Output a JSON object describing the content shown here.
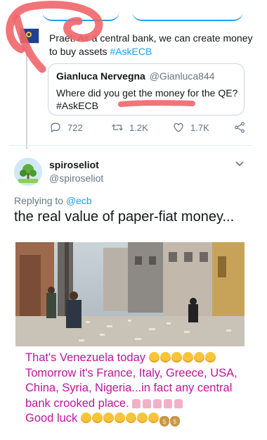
{
  "quoted_context": {
    "text_line1": "Praet: As a central bank, we can create money",
    "text_line2_prefix": "to buy assets ",
    "hashtag": "#AskECB"
  },
  "quote": {
    "author_name": "Gianluca Nervegna",
    "author_handle": "@Gianluca844",
    "text_line1": "Where did you get the money for the QE?",
    "hashtag": "#AskECB"
  },
  "actions": {
    "replies": "722",
    "retweets": "1.2K",
    "likes": "1.7K"
  },
  "reply_tweet": {
    "display_name": "spiroseliot",
    "handle": "@spiroseliot",
    "replying_to_prefix": "Replying to ",
    "replying_to_handle": "@ecb",
    "text": "the real value of paper-fiat money..."
  },
  "caption": {
    "line1": "That's Venezuela today",
    "line2": "Tomorrow it's France, Italy, Greece, USA,",
    "line3": "China, Syria, Nigeria...in fact any central",
    "line4": "bank crooked place.",
    "line5": "Good luck"
  },
  "colors": {
    "accent": "#1da1f2",
    "caption": "#c0159b",
    "annotation_red": "#f0656a"
  },
  "icons": [
    "reply-icon",
    "retweet-icon",
    "like-icon",
    "share-icon",
    "chevron-down-icon",
    "ecb-logo-icon"
  ]
}
